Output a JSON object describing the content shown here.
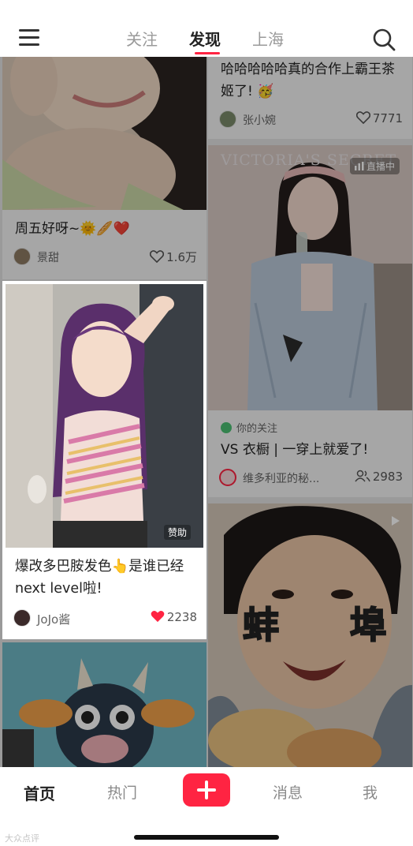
{
  "top_nav": {
    "tabs": [
      "关注",
      "发现",
      "上海"
    ],
    "active_tab": "发现",
    "menu_icon": "hamburger-menu-icon",
    "search_icon": "search-icon"
  },
  "feed": {
    "left": [
      {
        "title": "周五好呀~🌞🥖❤️",
        "author": "景甜",
        "likes": "1.6万"
      },
      {
        "title": "爆改多巴胺发色👆是谁已经next level啦!",
        "author": "JoJo酱",
        "likes": "2238",
        "sponsor_label": "赞助",
        "liked": true
      },
      {
        "title": "",
        "author": "",
        "likes": ""
      }
    ],
    "right": [
      {
        "title": "哈哈哈哈哈真的合作上霸王茶姬了! 🥳",
        "author": "张小婉",
        "likes": "7771"
      },
      {
        "brand_overlay": "VICTORIA'S SECRET",
        "live_label": "直播中",
        "follow_tag": "你的关注",
        "title": "VS 衣橱 | 一穿上就爱了!",
        "author": "维多利亚的秘...",
        "viewers": "2983"
      },
      {
        "overlay_text_left": "蚌",
        "overlay_text_right": "埠",
        "video_icon": "play-icon"
      }
    ]
  },
  "bottom_nav": {
    "items": [
      "首页",
      "热门",
      "消息",
      "我"
    ],
    "active": "首页",
    "plus_icon": "plus-icon"
  },
  "watermark": "大众点评"
}
